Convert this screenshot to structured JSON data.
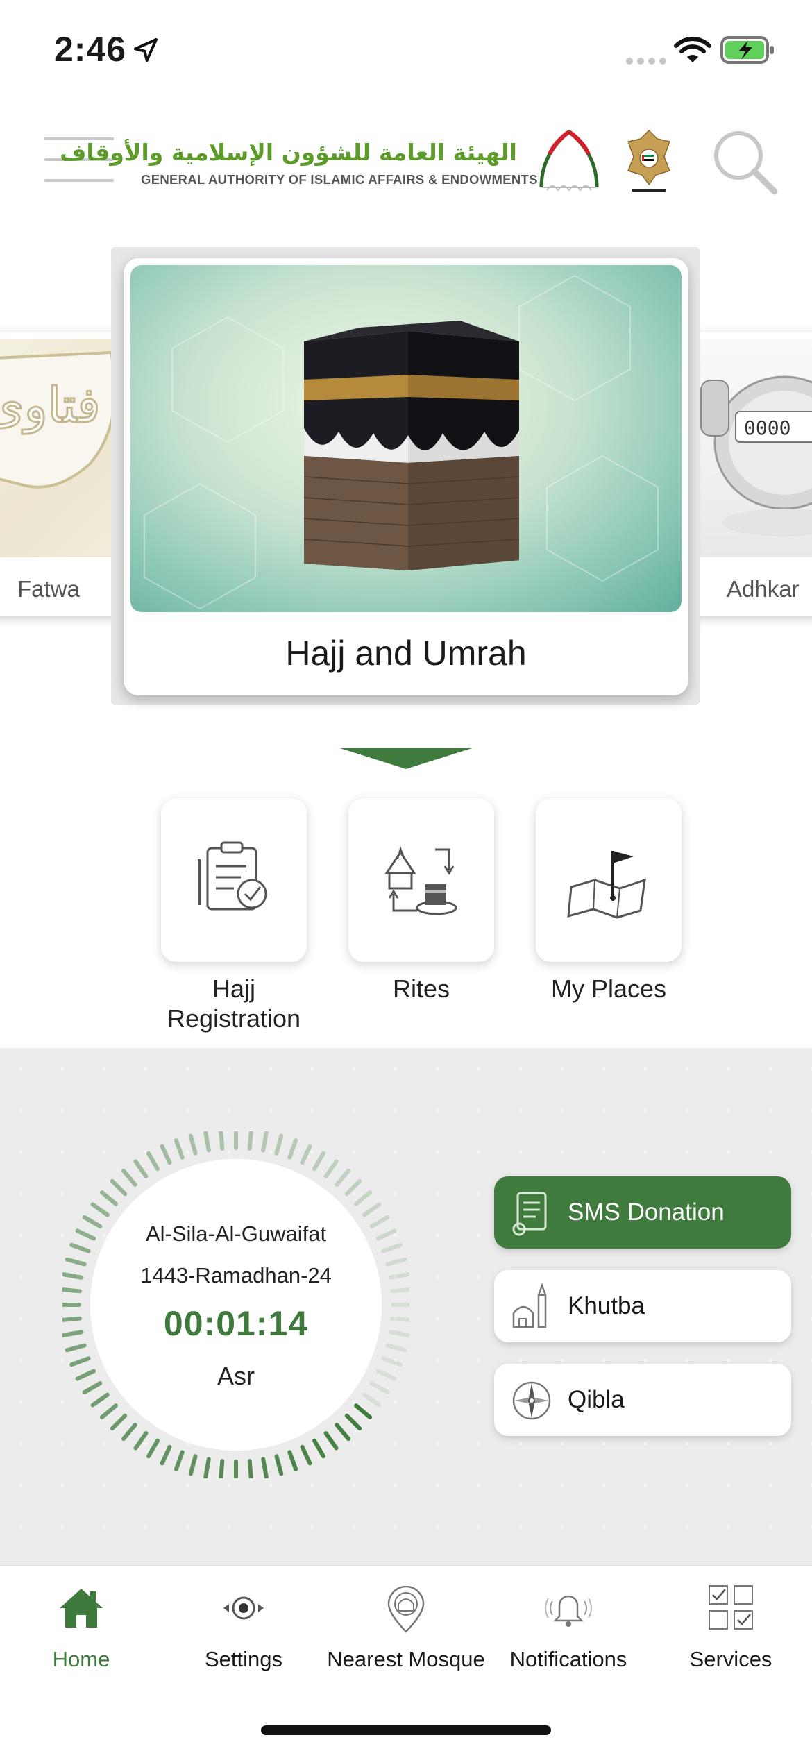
{
  "status_bar": {
    "time": "2:46"
  },
  "header": {
    "logo_arabic": "الهيئة العامة للشؤون الإسلامية والأوقاف",
    "logo_english": "GENERAL AUTHORITY OF ISLAMIC AFFAIRS & ENDOWMENTS",
    "emblem_caption": "United Arab Emirates"
  },
  "carousel": {
    "left_label": "Fatwa",
    "center_label": "Hajj and Umrah",
    "right_label": "Adhkar",
    "left_image_text": "فتاوى"
  },
  "quick_actions": [
    {
      "label": "Hajj\nRegistration",
      "line1": "Hajj",
      "line2": "Registration"
    },
    {
      "label": "Rites"
    },
    {
      "label": "My Places"
    }
  ],
  "prayer": {
    "location": "Al-Sila-Al-Guwaifat",
    "hijri_date": "1443-Ramadhan-24",
    "countdown": "00:01:14",
    "name": "Asr"
  },
  "action_buttons": [
    {
      "label": "SMS Donation",
      "icon": "sms-donation-icon"
    },
    {
      "label": "Khutba",
      "icon": "mosque-icon"
    },
    {
      "label": "Qibla",
      "icon": "compass-icon"
    }
  ],
  "tabs": [
    {
      "label": "Home",
      "icon": "home-icon",
      "active": true
    },
    {
      "label": "Settings",
      "icon": "eye-settings-icon",
      "active": false
    },
    {
      "label": "Nearest Mosque",
      "icon": "mosque-pin-icon",
      "active": false
    },
    {
      "label": "Notifications",
      "icon": "bell-icon",
      "active": false
    },
    {
      "label": "Services",
      "icon": "checklist-grid-icon",
      "active": false
    }
  ],
  "colors": {
    "primary_green": "#3f7b3d",
    "logo_green": "#5c9b2a",
    "tab_active": "#3d7a3b"
  }
}
